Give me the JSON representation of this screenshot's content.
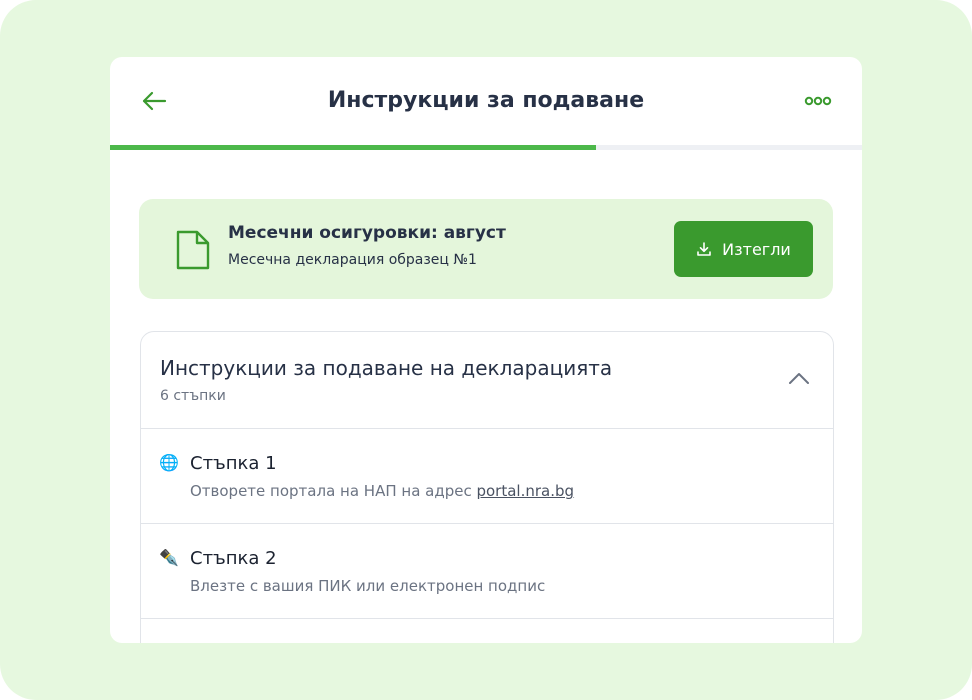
{
  "header": {
    "title": "Инструкции за подаване",
    "back_icon": "arrow-left-icon",
    "more_icon": "more-horizontal-icon"
  },
  "progress": {
    "fraction": 0.646
  },
  "colors": {
    "accent": "#3a9a2e",
    "progress": "#4cb84a",
    "card_background": "#e4f6db",
    "outer_background": "#e6f8df",
    "text_dark": "#273146",
    "text_muted": "#6b7382"
  },
  "download_card": {
    "icon": "file-icon",
    "title": "Месечни осигуровки: август",
    "subtitle": "Месечна декларация образец №1",
    "button_label": "Изтегли",
    "button_icon": "download-icon"
  },
  "accordion": {
    "title": "Инструкции за подаване на декларацията",
    "subtitle": "6 стъпки",
    "chevron_icon": "chevron-up-icon",
    "steps": [
      {
        "icon": "globe-icon",
        "glyph": "🌐",
        "title": "Стъпка 1",
        "description": "Отворете портала на НАП на адрес ",
        "link": "portal.nra.bg"
      },
      {
        "icon": "pen-icon",
        "glyph": "✒️",
        "title": "Стъпка 2",
        "description": "Влезте с вашия ПИК или електронен подпис"
      }
    ]
  }
}
